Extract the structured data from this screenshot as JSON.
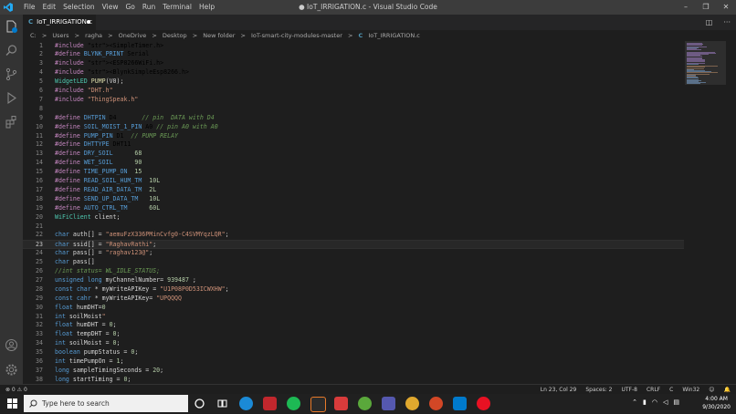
{
  "window": {
    "title": "● IoT_IRRIGATION.c - Visual Studio Code",
    "menu": [
      "File",
      "Edit",
      "Selection",
      "View",
      "Go",
      "Run",
      "Terminal",
      "Help"
    ],
    "controls": [
      "–",
      "❐",
      "✕"
    ]
  },
  "tab": {
    "label": "IoT_IRRIGATION.c",
    "lang_glyph": "C"
  },
  "breadcrumb": {
    "parts": [
      "C:",
      "Users",
      "ragha",
      "OneDrive",
      "Desktop",
      "New folder",
      "IoT-smart-city-modules-master",
      "IoT_IRRIGATION.c"
    ],
    "separator": ">"
  },
  "code_lines": [
    {
      "n": "1",
      "t": "#include <SimpleTimer.h>"
    },
    {
      "n": "2",
      "t": "#define BLYNK_PRINT Serial"
    },
    {
      "n": "3",
      "t": "#include <ESP8266WiFi.h>"
    },
    {
      "n": "4",
      "t": "#include <BlynkSimpleEsp8266.h>"
    },
    {
      "n": "5",
      "t": "WidgetLED PUMP(V0);"
    },
    {
      "n": "6",
      "t": "#include \"DHT.h\""
    },
    {
      "n": "7",
      "t": "#include \"ThingSpeak.h\""
    },
    {
      "n": "8",
      "t": ""
    },
    {
      "n": "9",
      "t": "#define DHTPIN D4       // pin  DATA with D4"
    },
    {
      "n": "10",
      "t": "#define SOIL_MOIST_1_PIN A0 // pin A0 with A0"
    },
    {
      "n": "11",
      "t": "#define PUMP_PIN D1  // PUMP RELAY"
    },
    {
      "n": "12",
      "t": "#define DHTTYPE DHT11"
    },
    {
      "n": "13",
      "t": "#define DRY_SOIL      68"
    },
    {
      "n": "14",
      "t": "#define WET_SOIL      90"
    },
    {
      "n": "15",
      "t": "#define TIME_PUMP_ON  15"
    },
    {
      "n": "16",
      "t": "#define READ_SOIL_HUM_TM  10L"
    },
    {
      "n": "17",
      "t": "#define READ_AIR_DATA_TM  2L"
    },
    {
      "n": "18",
      "t": "#define SEND_UP_DATA_TM   10L"
    },
    {
      "n": "19",
      "t": "#define AUTO_CTRL_TM      60L"
    },
    {
      "n": "20",
      "t": "WiFiClient client;"
    },
    {
      "n": "21",
      "t": ""
    },
    {
      "n": "22",
      "t": "char auth[] = \"aemuFzX336PMinCvfg0-C4SVMYqzLQR\";"
    },
    {
      "n": "23",
      "t": "char ssid[] = \"RaghavRathi\";"
    },
    {
      "n": "24",
      "t": "char pass[] = \"raghav123@\";"
    },
    {
      "n": "25",
      "t": "char pass[]"
    },
    {
      "n": "26",
      "t": "//int status= WL_IDLE_STATUS;"
    },
    {
      "n": "27",
      "t": "unsigned long myChannelNumber= 939487 ;"
    },
    {
      "n": "28",
      "t": "const char * myWriteAPIKey = \"U1P08P0D53ICWXHW\";"
    },
    {
      "n": "29",
      "t": "const cahr * myWriteAPIKey= \"UPQQQQ"
    },
    {
      "n": "30",
      "t": "float humDHT=0"
    },
    {
      "n": "31",
      "t": "int soilMoist\""
    },
    {
      "n": "32",
      "t": "float humDHT = 0;"
    },
    {
      "n": "33",
      "t": "float tempDHT = 0;"
    },
    {
      "n": "34",
      "t": "int soilMoist = 0;"
    },
    {
      "n": "35",
      "t": "boolean pumpStatus = 0;"
    },
    {
      "n": "36",
      "t": "int timePumpOn = 1;"
    },
    {
      "n": "37",
      "t": "long sampleTimingSeconds = 20;"
    },
    {
      "n": "38",
      "t": "long startTiming = 0;"
    }
  ],
  "status": {
    "left": "⊗ 0 ⚠ 0",
    "right": [
      "Ln 23, Col 29",
      "Spaces: 2",
      "UTF-8",
      "CRLF",
      "C",
      "Win32"
    ]
  },
  "taskbar": {
    "search_placeholder": "Type here to search",
    "time": "4:00 AM",
    "date": "9/30/2020"
  },
  "colors": {
    "accent": "#007acc",
    "keyword": "#569cd6",
    "string": "#ce9178",
    "number": "#b5cea8",
    "comment": "#6a9955"
  },
  "icons": {
    "activity": [
      "files-icon",
      "search-icon",
      "source-control-icon",
      "run-debug-icon",
      "extensions-icon",
      "account-icon",
      "settings-gear-icon"
    ],
    "taskbar": [
      "edge-icon",
      "pdf-icon",
      "spotify-icon",
      "terminal-icon",
      "snipping-icon",
      "excel-icon",
      "teams-icon",
      "chrome-icon",
      "powerpoint-icon",
      "vscode-icon",
      "recorder-icon"
    ]
  }
}
